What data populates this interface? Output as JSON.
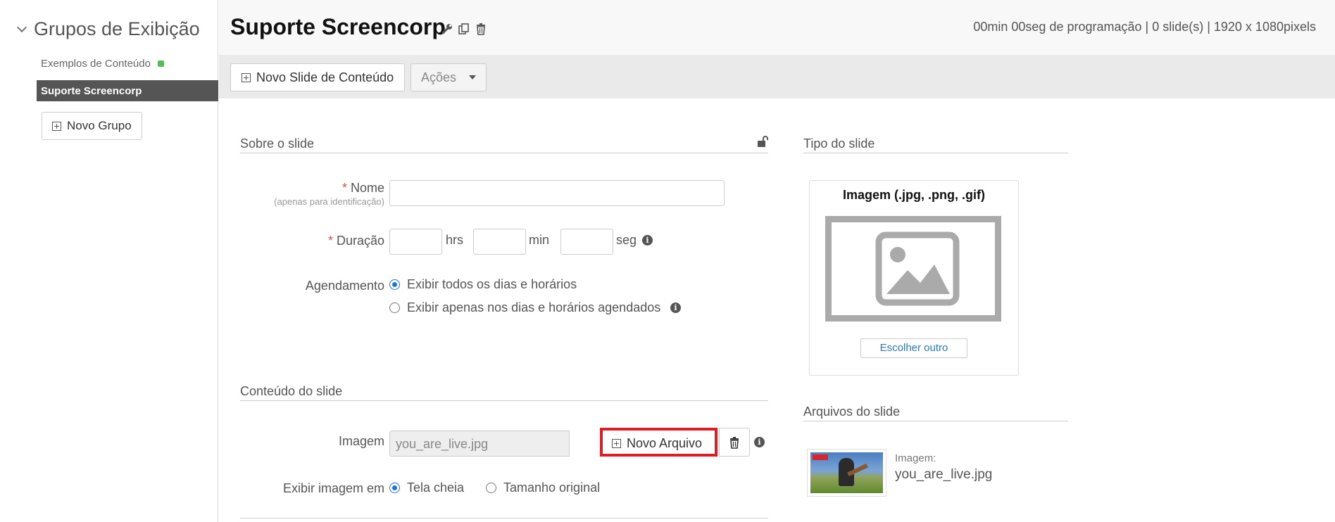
{
  "sidebar": {
    "header": "Grupos de Exibição",
    "items": [
      {
        "label": "Exemplos de Conteúdo",
        "status_color": "#5cb85c"
      },
      {
        "label": "Suporte Screencorp",
        "active": true
      }
    ],
    "new_group_label": "Novo Grupo"
  },
  "header": {
    "title": "Suporte Screencorp",
    "icons": [
      "wrench-icon",
      "copy-icon",
      "trash-icon"
    ],
    "info": "00min 00seg de programação | 0 slide(s) | 1920 x 1080pixels"
  },
  "toolbar": {
    "new_slide_label": "Novo Slide de Conteúdo",
    "actions_label": "Ações"
  },
  "about": {
    "section_title": "Sobre o slide",
    "name_label": "Nome",
    "name_sublabel": "(apenas para identificação)",
    "name_value": "",
    "duration_label": "Duração",
    "hrs_unit": "hrs",
    "min_unit": "min",
    "seg_unit": "seg",
    "schedule_label": "Agendamento",
    "schedule_options": [
      "Exibir todos os dias e horários",
      "Exibir apenas nos dias e horários agendados"
    ],
    "schedule_selected": 0
  },
  "content": {
    "section_title": "Conteúdo do slide",
    "image_label": "Imagem",
    "image_value": "you_are_live.jpg",
    "new_file_label": "Novo Arquivo",
    "display_label": "Exibir imagem em",
    "display_options": [
      "Tela cheia",
      "Tamanho original"
    ],
    "display_selected": 0
  },
  "slide_type": {
    "section_title": "Tipo do slide",
    "card_title": "Imagem (.jpg, .png, .gif)",
    "choose_label": "Escolher outro"
  },
  "slide_files": {
    "section_title": "Arquivos do slide",
    "caption": "Imagem:",
    "filename": "you_are_live.jpg"
  },
  "colors": {
    "accent": "#1a73e8",
    "highlight": "#e01b24",
    "sidebar_active": "#555555",
    "status_green": "#5cb85c"
  }
}
